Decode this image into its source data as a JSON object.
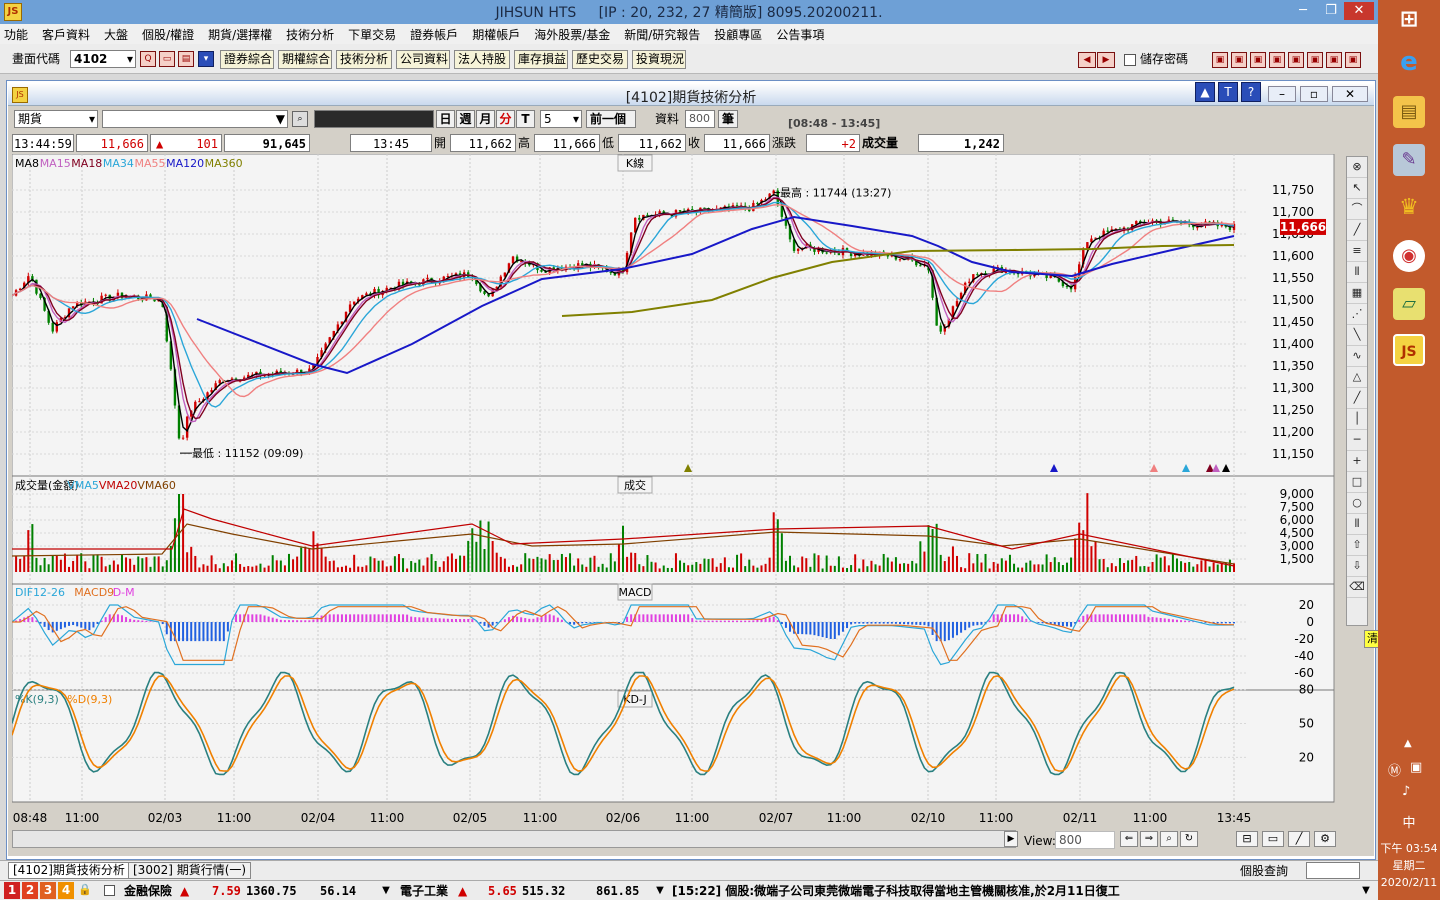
{
  "window": {
    "app": "JIHSUN HTS",
    "conn": "[IP : 20, 232, 27 精簡版] 8095.20200211."
  },
  "menu": [
    "功能",
    "客戶資料",
    "大盤",
    "個股/權證",
    "期貨/選擇權",
    "技術分析",
    "下單交易",
    "證券帳戶",
    "期權帳戶",
    "海外股票/基金",
    "新聞/研究報告",
    "投顧專區",
    "公告事項"
  ],
  "toolbar": {
    "code_label": "畫面代碼",
    "code_value": "4102",
    "buttons": [
      "證券綜合",
      "期權綜合",
      "技術分析",
      "公司資料",
      "法人持股",
      "庫存損益",
      "歷史交易",
      "投資現況"
    ],
    "save_pwd": "儲存密碼"
  },
  "chart_window": {
    "title": "[4102]期貨技術分析",
    "market": "期貨",
    "periods": [
      "日",
      "週",
      "月",
      "分",
      "T"
    ],
    "period_active": "分",
    "interval": "5",
    "prev": "前一個",
    "data_label": "資料",
    "data_count": "800",
    "unit": "筆",
    "range": "[08:48 - 13:45]"
  },
  "quote": {
    "time": "13:44:59",
    "last": "11,666",
    "change": "101",
    "volume_total": "91,645",
    "bar_time": "13:45",
    "open_l": "開",
    "open": "11,662",
    "high_l": "高",
    "high": "11,666",
    "low_l": "低",
    "low": "11,662",
    "close_l": "收",
    "close": "11,666",
    "chg_l": "漲跌",
    "chg": "+2",
    "vol_l": "成交量",
    "vol": "1,242"
  },
  "panels": {
    "k": {
      "title": "K線",
      "legend": [
        {
          "t": "MA8",
          "c": "#000000"
        },
        {
          "t": "MA15",
          "c": "#c060c0"
        },
        {
          "t": "MA18",
          "c": "#800020"
        },
        {
          "t": "MA34",
          "c": "#2aa6d8"
        },
        {
          "t": "MA55",
          "c": "#f08080"
        },
        {
          "t": "MA120",
          "c": "#1818c8"
        },
        {
          "t": "MA360",
          "c": "#808000"
        }
      ],
      "high_note": "最高 : 11744 (13:27)",
      "low_note": "最低 : 11152 (09:09)",
      "y_ticks": [
        "11,750",
        "11,700",
        "11,650",
        "11,600",
        "11,550",
        "11,500",
        "11,450",
        "11,400",
        "11,350",
        "11,300",
        "11,250",
        "11,200",
        "11,150"
      ],
      "last_price": "11,666"
    },
    "v": {
      "title": "成交",
      "legend": [
        {
          "t": "成交量(金額)",
          "c": "#000000"
        },
        {
          "t": "VMA5",
          "c": "#2aa6d8"
        },
        {
          "t": "VMA20",
          "c": "#c00000"
        },
        {
          "t": "VMA60",
          "c": "#804000"
        }
      ],
      "y_ticks": [
        "9,000",
        "7,500",
        "6,000",
        "4,500",
        "3,000",
        "1,500"
      ]
    },
    "m": {
      "title": "MACD",
      "legend": [
        {
          "t": "DIF12-26",
          "c": "#2aa6d8"
        },
        {
          "t": "MACD9",
          "c": "#e07020"
        },
        {
          "t": "D-M",
          "c": "#e040e0"
        }
      ],
      "y_ticks": [
        "20",
        "0",
        "-20",
        "-40",
        "-60"
      ]
    },
    "kd": {
      "title": "KD-J",
      "legend": [
        {
          "t": "%K(9,3)",
          "c": "#2a8080"
        },
        {
          "t": "%D(9,3)",
          "c": "#f08000"
        }
      ],
      "y_ticks": [
        "80",
        "50",
        "20"
      ]
    }
  },
  "x_ticks": [
    "08:48",
    "11:00",
    "02/03",
    "11:00",
    "02/04",
    "11:00",
    "02/05",
    "11:00",
    "02/06",
    "11:00",
    "02/07",
    "11:00",
    "02/10",
    "11:00",
    "02/11",
    "11:00",
    "13:45"
  ],
  "view": {
    "label": "View:",
    "value": "800"
  },
  "clear_label": "清除",
  "tabs": [
    "[4102]期貨技術分析",
    "[3002] 期貨行情(一)"
  ],
  "stock_query": "個股查詢",
  "status": {
    "s1_name": "金融保險",
    "s1_chg": "7.59",
    "s1_idx": "1360.75",
    "s1_amt": "56.14",
    "s2_name": "電子工業",
    "s2_chg": "5.65",
    "s2_idx": "515.32",
    "s2_amt": "861.85",
    "news": "[15:22] 個股:微端子公司東莞微端電子科技取得當地主管機關核准,於2月11日復工"
  },
  "clock": {
    "time": "下午 03:54",
    "weekday": "星期二",
    "date": "2020/2/11",
    "ime": "中"
  }
}
